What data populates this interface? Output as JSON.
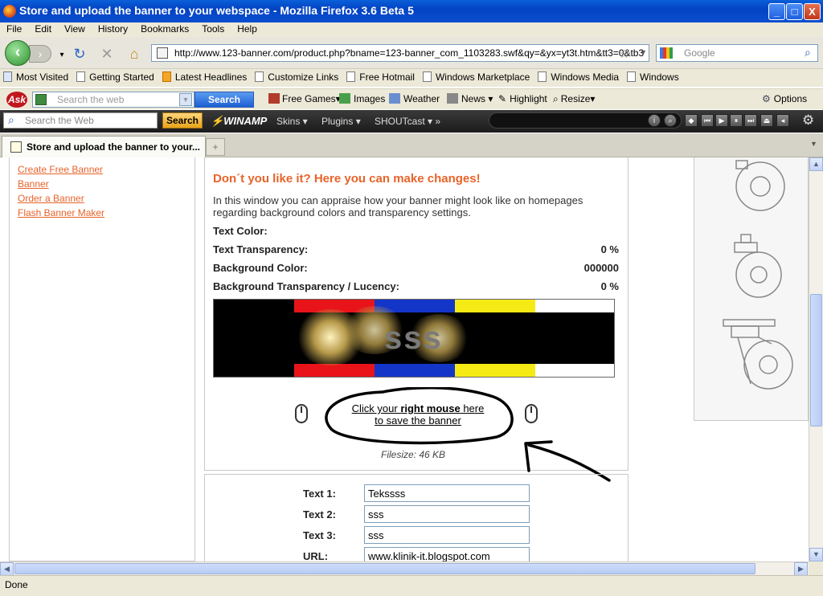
{
  "window": {
    "title": "Store and upload the banner to your webspace - Mozilla Firefox 3.6 Beta 5",
    "min_label": "_",
    "max_label": "□",
    "close_label": "X"
  },
  "menu": [
    "File",
    "Edit",
    "View",
    "History",
    "Bookmarks",
    "Tools",
    "Help"
  ],
  "nav": {
    "url": "http://www.123-banner.com/product.php?bname=123-banner_com_1103283.swf&qy=&yx=yt3t.htm&tt3=0&tb3",
    "search_placeholder": "Google"
  },
  "bookmarks": [
    "Most Visited",
    "Getting Started",
    "Latest Headlines",
    "Customize Links",
    "Free Hotmail",
    "Windows Marketplace",
    "Windows Media",
    "Windows"
  ],
  "ask_toolbar": {
    "logo": "Ask",
    "search_placeholder": "Search the web",
    "search_button": "Search",
    "items": [
      "Free Games▾",
      "Images",
      "Weather",
      "News",
      "Highlight",
      "Resize▾"
    ],
    "options": "Options"
  },
  "winamp_toolbar": {
    "search_placeholder": "Search the Web",
    "search_button": "Search",
    "logo": "WINAMP",
    "menus": [
      "Skins",
      "Plugins",
      "SHOUTcast"
    ]
  },
  "tab": {
    "label": "Store and upload the banner to your...",
    "new_tab": "+"
  },
  "sidebar": {
    "links": [
      "Create Free Banner",
      "Banner",
      "Order a Banner",
      "Flash Banner Maker"
    ]
  },
  "main": {
    "heading": "Don´t you like it? Here you can make changes!",
    "description": "In this window you can appraise how your banner might look like on homepages regarding background colors and transparency settings.",
    "props": [
      {
        "label": "Text Color:",
        "value": ""
      },
      {
        "label": "Text Transparency:",
        "value": "0 %"
      },
      {
        "label": "Background Color:",
        "value": "000000"
      },
      {
        "label": "Background Transparency / Lucency:",
        "value": "0 %"
      }
    ],
    "banner_text": "sss",
    "save_prefix": "Click your ",
    "save_bold": "right mouse",
    "save_suffix": " here",
    "save_line2": "to save the banner",
    "filesize": "Filesize: 46 KB",
    "form": [
      {
        "label": "Text 1:",
        "value": "Tekssss"
      },
      {
        "label": "Text 2:",
        "value": "sss"
      },
      {
        "label": "Text 3:",
        "value": "sss"
      },
      {
        "label": "URL:",
        "value": "www.klinik-it.blogspot.com"
      }
    ]
  },
  "status": "Done",
  "colors": {
    "accent_orange": "#e8632a",
    "title_blue": "#0a4fd0"
  }
}
